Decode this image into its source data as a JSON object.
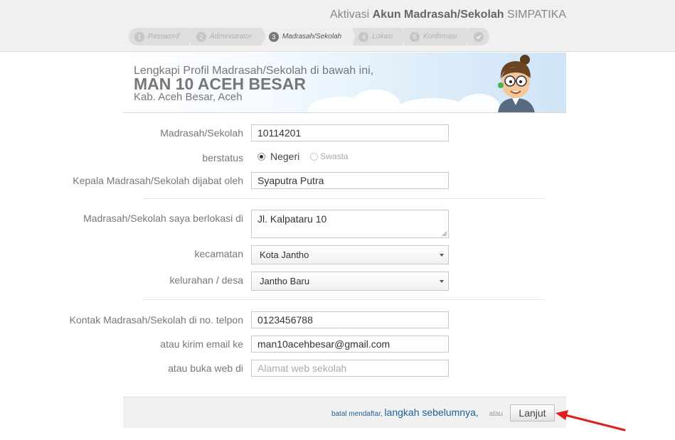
{
  "header": {
    "title_prefix": "Aktivasi",
    "title_bold": "Akun Madrasah/Sekolah",
    "title_suffix": "SIMPATIKA"
  },
  "steps": [
    {
      "num": "1",
      "label": "Password",
      "state": "pending"
    },
    {
      "num": "2",
      "label": "Administrator",
      "state": "pending"
    },
    {
      "num": "3",
      "label": "Madrasah/Sekolah",
      "state": "active"
    },
    {
      "num": "4",
      "label": "Lokasi",
      "state": "pending"
    },
    {
      "num": "5",
      "label": "Konfirmasi",
      "state": "pending"
    },
    {
      "icon": "checkmark-icon",
      "state": "final"
    }
  ],
  "banner": {
    "intro": "Lengkapi Profil Madrasah/Sekolah di bawah ini,",
    "school_name": "MAN 10 ACEH BESAR",
    "region": "Kab. Aceh Besar, Aceh",
    "mascot_icon": "mascot-illustration"
  },
  "form": {
    "school_id": {
      "label": "Madrasah/Sekolah",
      "value": "10114201"
    },
    "status": {
      "label": "berstatus",
      "options": [
        {
          "label": "Negeri",
          "selected": true
        },
        {
          "label": "Swasta",
          "selected": false
        }
      ]
    },
    "principal": {
      "label": "Kepala Madrasah/Sekolah dijabat oleh",
      "value": "Syaputra Putra"
    },
    "address": {
      "label": "Madrasah/Sekolah saya berlokasi di",
      "value": "Jl. Kalpataru 10"
    },
    "district": {
      "label": "kecamatan",
      "value": "Kota Jantho"
    },
    "village": {
      "label": "kelurahan / desa",
      "value": "Jantho Baru"
    },
    "phone": {
      "label": "Kontak Madrasah/Sekolah di no. telpon",
      "value": "0123456788"
    },
    "email": {
      "label": "atau kirim email ke",
      "value": "man10acehbesar@gmail.com"
    },
    "website": {
      "label": "atau buka web di",
      "value": "",
      "placeholder": "Alamat web sekolah"
    }
  },
  "footer": {
    "cancel_label": "batal mendaftar,",
    "back_label": "langkah sebelumnya,",
    "or_label": "atau",
    "next_label": "Lanjut"
  },
  "colors": {
    "link": "#1f5f9e",
    "arrow": "#e02020",
    "header_bg": "#f0f0f0"
  }
}
